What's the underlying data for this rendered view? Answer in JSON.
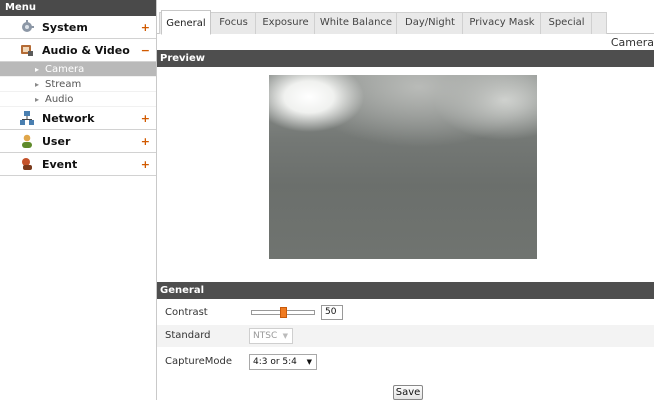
{
  "sidebar": {
    "header": "Menu",
    "categories": [
      {
        "label": "System",
        "sign": "+",
        "icon": "system-icon",
        "color": "#7c8a9a"
      },
      {
        "label": "Audio & Video",
        "sign": "−",
        "icon": "audio-video-icon",
        "color": "#a2612f"
      },
      {
        "label": "Network",
        "sign": "+",
        "icon": "network-icon",
        "color": "#3e6f9e"
      },
      {
        "label": "User",
        "sign": "+",
        "icon": "user-icon",
        "color": "#6c8a2f"
      },
      {
        "label": "Event",
        "sign": "+",
        "icon": "event-icon",
        "color": "#b0471d"
      }
    ],
    "subitems": [
      "Camera",
      "Stream",
      "Audio"
    ],
    "active_subitem": "Camera"
  },
  "tabs": [
    "General",
    "Focus",
    "Exposure",
    "White Balance",
    "Day/Night",
    "Privacy Mask",
    "Special"
  ],
  "active_tab": "General",
  "breadcrumb": "Camera",
  "preview_section": {
    "title": "Preview"
  },
  "general_section": {
    "title": "General",
    "contrast": {
      "label": "Contrast",
      "value": "50",
      "fraction": 0.5
    },
    "standard": {
      "label": "Standard",
      "value": "NTSC",
      "disabled": true
    },
    "capture_mode": {
      "label": "CaptureMode",
      "value": "4:3 or 5:4"
    }
  },
  "save_label": "Save",
  "colors": {
    "accent": "#f07b21",
    "header_bar": "#4e4e4e"
  }
}
